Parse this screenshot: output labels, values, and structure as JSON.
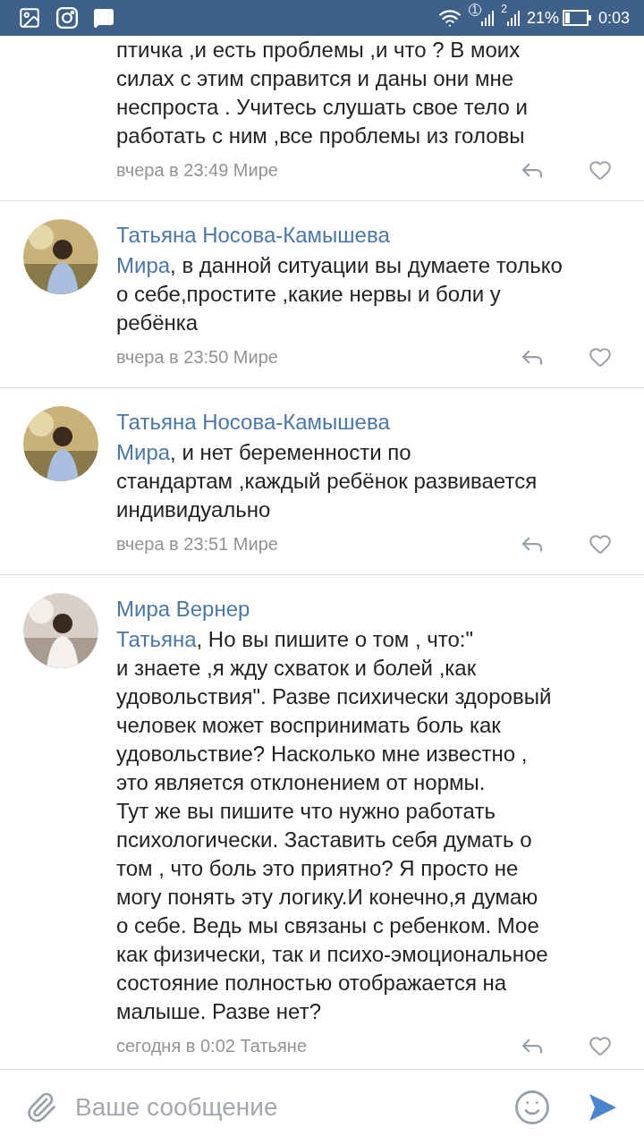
{
  "status_bar": {
    "sim1": "1",
    "sim2": "2",
    "battery": "21%",
    "time": "0:03"
  },
  "comments": [
    {
      "body": "птичка ,и есть проблемы ,и что ? В моих\nсилах с этим справится и даны они мне\nнеспроста . Учитесь слушать свое тело и\nработать с ним ,все проблемы из головы",
      "meta": "вчера в 23:49 Мире",
      "liked": false
    },
    {
      "author": "Татьяна Носова-Камышева",
      "mention": "Мира",
      "body": ", в данной ситуации вы думаете только\nо себе,простите ,какие нервы и боли у\nребёнка",
      "meta": "вчера в 23:50 Мире",
      "liked": false
    },
    {
      "author": "Татьяна Носова-Камышева",
      "mention": "Мира",
      "body": ", и нет беременности по\nстандартам ,каждый ребёнок развивается\nиндивидуально",
      "meta": "вчера в 23:51 Мире",
      "liked": false
    },
    {
      "author": "Мира Вернер",
      "mention": "Татьяна",
      "body": ", Но вы пишите о том , что:\"\nи знаете ,я жду схваток и болей ,как\nудовольствия\". Разве психически здоровый\nчеловек может воспринимать боль как\nудовольствие? Насколько мне известно ,\nэто является отклонением от нормы.\nТут же вы пишите что нужно работать\nпсихологически. Заставить себя думать о\nтом , что боль это приятно? Я просто не\nмогу понять эту логику.И конечно,я думаю\nо себе. Ведь мы связаны с ребенком. Мое\nкак физически, так и психо-эмоциональное\nсостояние полностью отображается на\nмалыше. Разве нет?",
      "meta": "сегодня в 0:02 Татьяне",
      "liked": false
    }
  ],
  "composer": {
    "placeholder": "Ваше сообщение"
  }
}
